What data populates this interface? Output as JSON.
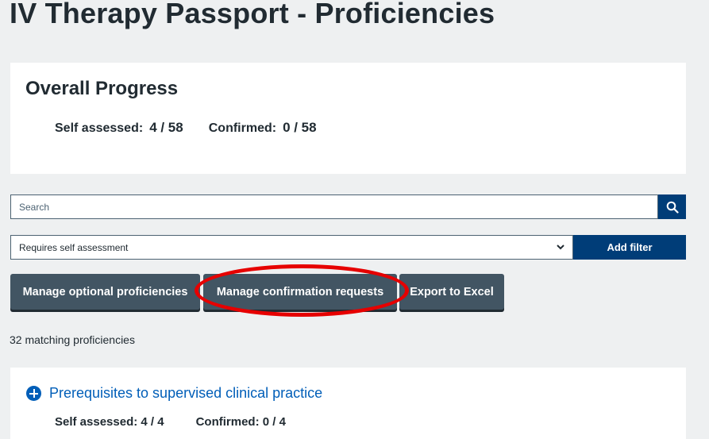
{
  "page_title": "IV Therapy Passport - Proficiencies",
  "overall_progress": {
    "title": "Overall Progress",
    "self_assessed_label": "Self assessed:",
    "self_assessed_value": "4 / 58",
    "confirmed_label": "Confirmed:",
    "confirmed_value": "0 / 58"
  },
  "search": {
    "placeholder": "Search"
  },
  "filter": {
    "selected": "Requires self assessment",
    "add_label": "Add filter"
  },
  "actions": {
    "optional": "Manage optional proficiencies",
    "confirm": "Manage confirmation requests",
    "export": "Export to Excel"
  },
  "match_count": "32 matching proficiencies",
  "sections": [
    {
      "title": "Prerequisites to supervised clinical practice",
      "self_assessed": "Self assessed: 4 / 4",
      "confirmed": "Confirmed: 0 / 4"
    }
  ],
  "colors": {
    "background": "#eef0f1",
    "primary_blue": "#003d78",
    "link_blue": "#005eb8",
    "button_grey": "#425563",
    "highlight_red": "#e60000"
  }
}
